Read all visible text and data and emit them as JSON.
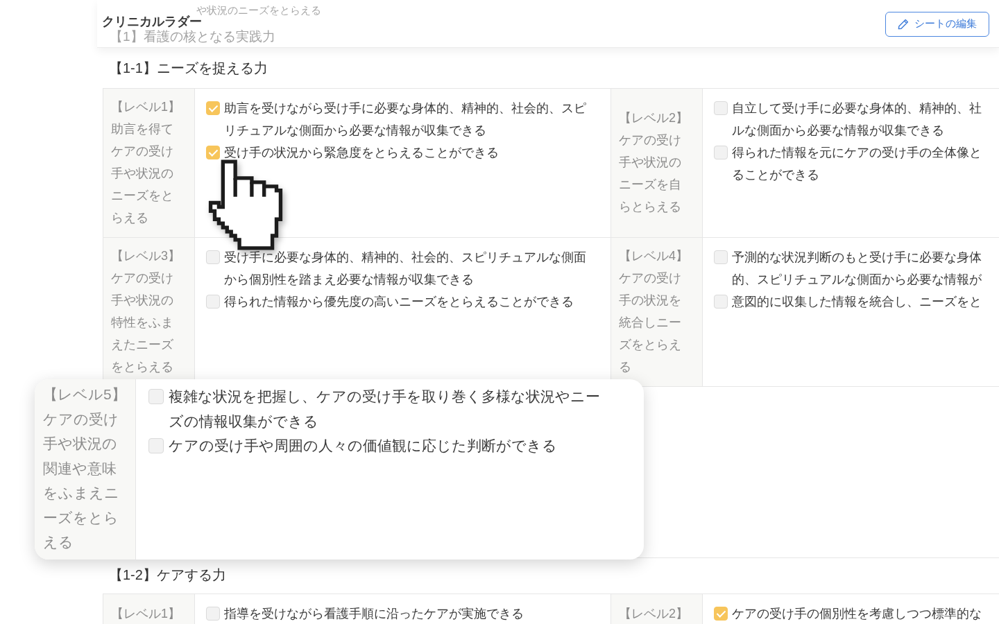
{
  "header": {
    "title": "クリニカルラダー",
    "edit_button": "シートの編集",
    "behind": [
      {
        "kind": "caption",
        "text": "や状況のニーズをとらえる"
      },
      {
        "kind": "heading",
        "text": "【1】看護の核となる実践力"
      }
    ]
  },
  "sections": [
    {
      "title": "【1-1】ニーズを捉える力",
      "rows": [
        {
          "magnified": false,
          "cells": [
            {
              "level": "【レベル1】",
              "description": "助言を得てケアの受け手や状況のニーズをとらえる",
              "items": [
                {
                  "text": "助言を受けながら受け手に必要な身体的、精神的、社会的、スピリチュアルな側面から必要な情報が収集できる",
                  "checked": true
                },
                {
                  "text": "受け手の状況から緊急度をとらえることができる",
                  "checked": true
                }
              ]
            },
            {
              "level": "【レベル2】",
              "description": "ケアの受け手や状況のニーズを自らとらえる",
              "items": [
                {
                  "lines": [
                    "自立して受け手に必要な身体的、精神的、社",
                    "ルな側面から必要な情報が収集できる"
                  ],
                  "checked": false
                },
                {
                  "lines": [
                    "得られた情報を元にケアの受け手の全体像と",
                    "ることができる"
                  ],
                  "checked": false
                }
              ]
            }
          ]
        },
        {
          "magnified": false,
          "cells": [
            {
              "level": "【レベル3】",
              "description": "ケアの受け手や状況の特性をふまえたニーズをとらえる",
              "items": [
                {
                  "text": "受け手に必要な身体的、精神的、社会的、スピリチュアルな側面から個別性を踏まえ必要な情報が収集できる",
                  "checked": false
                },
                {
                  "text": "得られた情報から優先度の高いニーズをとらえることができる",
                  "checked": false
                }
              ]
            },
            {
              "level": "【レベル4】",
              "description": "ケアの受け手の状況を統合しニーズをとらえる",
              "items": [
                {
                  "lines": [
                    "予測的な状況判断のもと受け手に必要な身体",
                    "的、スピリチュアルな側面から必要な情報が"
                  ],
                  "checked": false
                },
                {
                  "lines": [
                    "意図的に収集した情報を統合し、ニーズをと"
                  ],
                  "checked": false
                }
              ]
            }
          ]
        },
        {
          "magnified": true,
          "cells": [
            {
              "level": "【レベル5】",
              "description": "ケアの受け手や状況の関連や意味をふまえニーズをとらえる",
              "items": [
                {
                  "text": "複雑な状況を把握し、ケアの受け手を取り巻く多様な状況やニーズの情報収集ができる",
                  "checked": false
                },
                {
                  "text": "ケアの受け手や周囲の人々の価値観に応じた判断ができる",
                  "checked": false
                }
              ]
            }
          ]
        }
      ]
    },
    {
      "title": "【1-2】ケアする力",
      "rows": [
        {
          "magnified": false,
          "cells": [
            {
              "level": "【レベル1】",
              "items": [
                {
                  "text": "指導を受けながら看護手順に沿ったケアが実施できる",
                  "checked": false
                }
              ]
            },
            {
              "level": "【レベル2】",
              "items": [
                {
                  "lines": [
                    "ケアの受け手の個別性を考慮しつつ標準的な"
                  ],
                  "checked": true
                }
              ]
            }
          ]
        }
      ]
    }
  ]
}
